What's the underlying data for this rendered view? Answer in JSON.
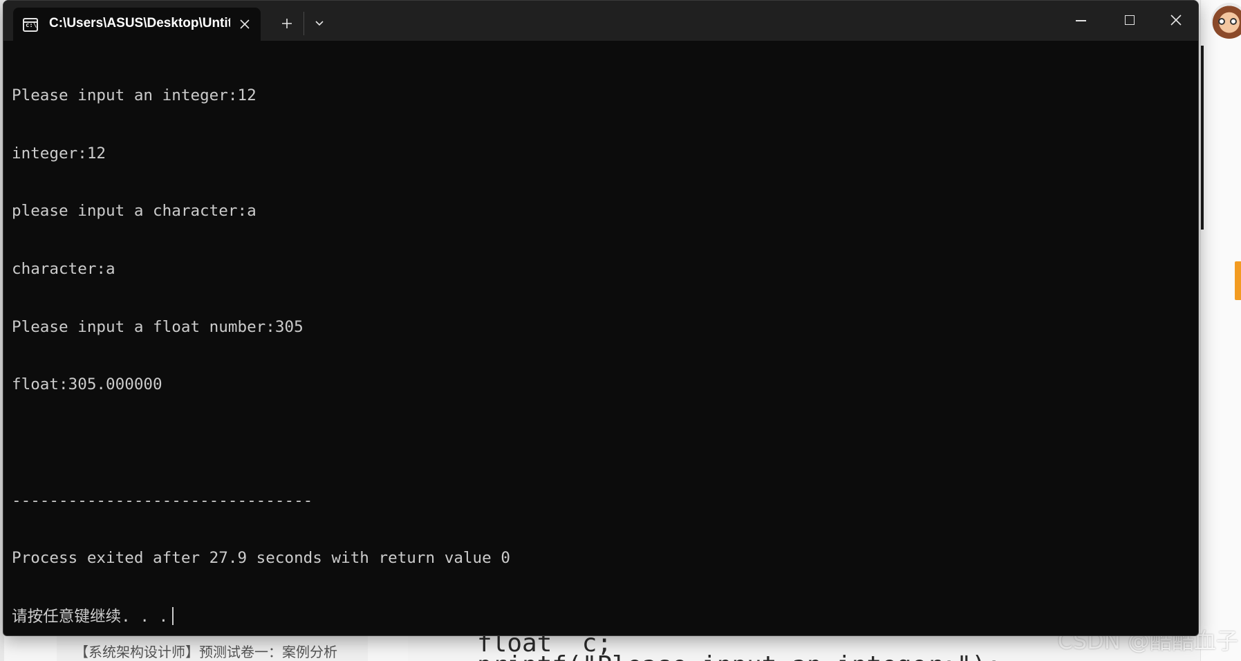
{
  "window": {
    "tab_title": "C:\\Users\\ASUS\\Desktop\\Untit",
    "tab_icon": "terminal-icon",
    "close_tab_icon": "close-icon",
    "new_tab_icon": "plus-icon",
    "dropdown_icon": "chevron-down-icon"
  },
  "console": {
    "lines": [
      "Please input an integer:12",
      "integer:12",
      "please input a character:a",
      "character:a",
      "Please input a float number:305",
      "float:305.000000",
      "",
      "--------------------------------",
      "Process exited after 27.9 seconds with return value 0",
      "请按任意键继续. . ."
    ]
  },
  "background": {
    "article_link": "【系统架构设计师】预测试卷一：案例分析",
    "code_line_1": "float  c;",
    "code_line_2": "printf(\"Please input an integer:\");",
    "watermark": "CSDN @酷酷血子"
  },
  "colors": {
    "terminal_bg": "#0c0c0c",
    "title_bar_bg": "#202020",
    "text": "#cccccc",
    "accent_orange": "#f29b21"
  }
}
